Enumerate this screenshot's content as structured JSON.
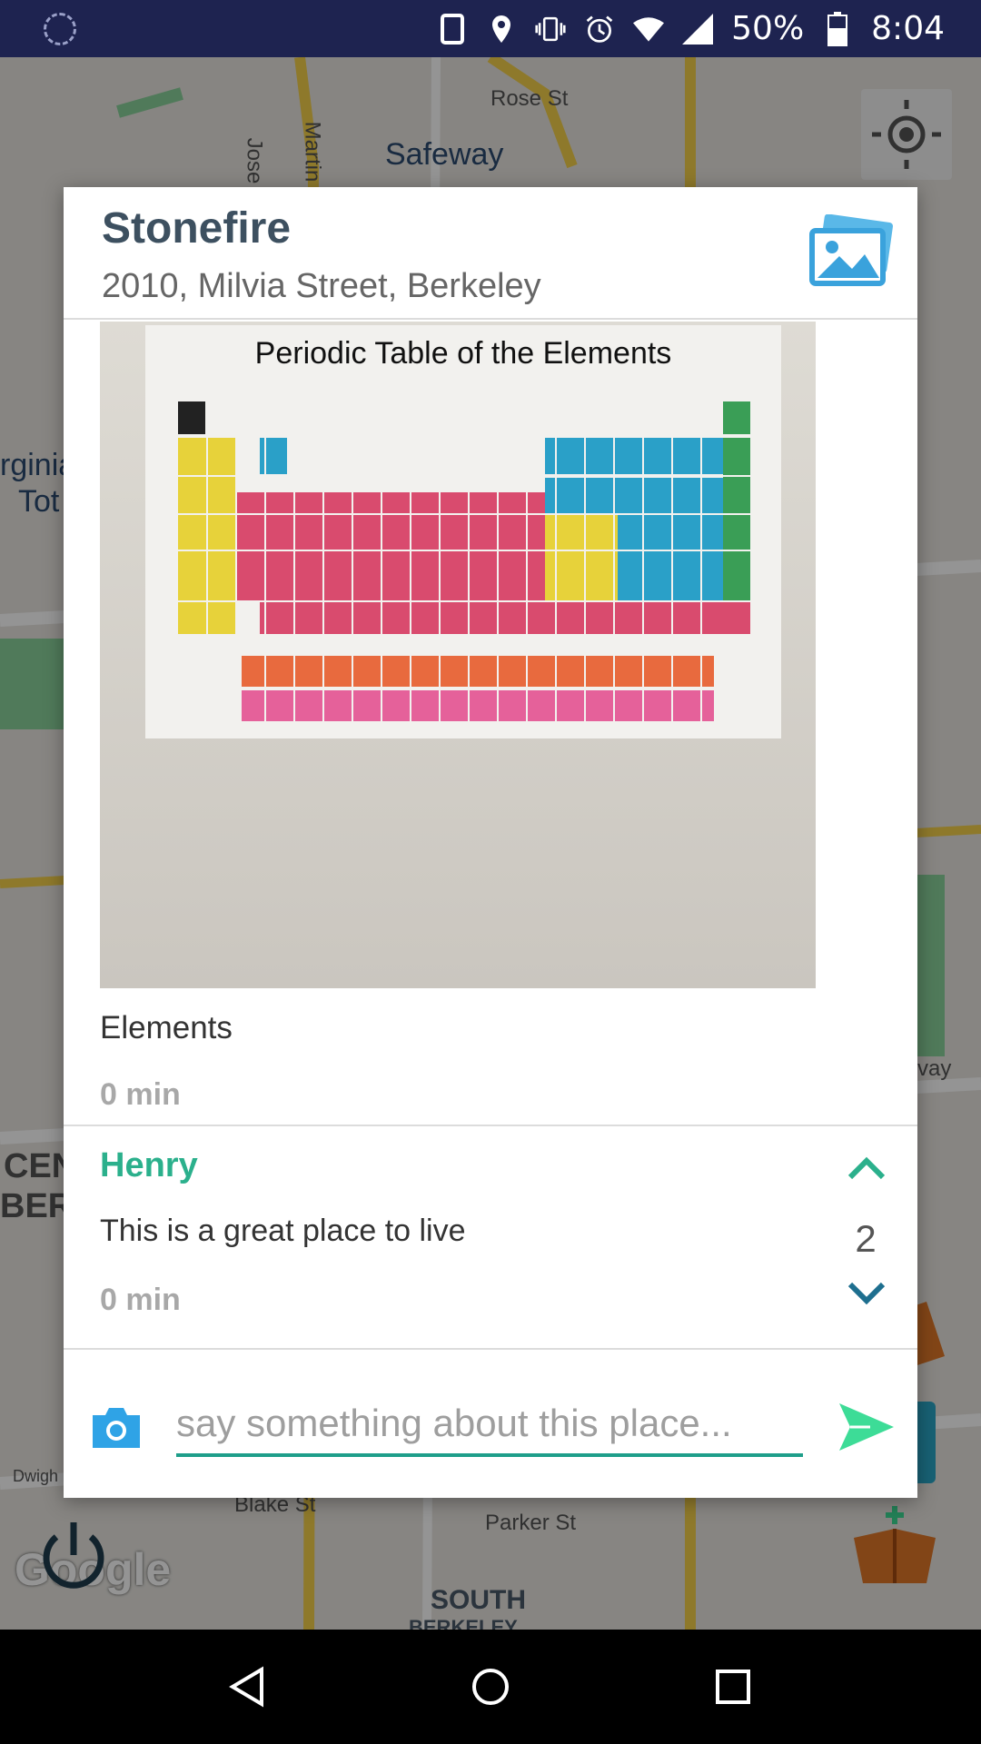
{
  "status_bar": {
    "battery": "50%",
    "time": "8:04"
  },
  "map": {
    "labels": {
      "rose_st": "Rose St",
      "safeway": "Safeway",
      "jose": "Jose",
      "martin": "Martin",
      "virginia": "rginia",
      "tot": "Tot",
      "cen": "CEN",
      "ber": "BER",
      "blake_st": "Blake St",
      "parker_st": "Parker St",
      "south": "SOUTH",
      "berkeley": "BERKELEY",
      "dwight": "Dwigh",
      "way": "vay",
      "google": "Google"
    }
  },
  "dialog": {
    "title": "Stonefire",
    "address": "2010, Milvia Street, Berkeley",
    "photo": {
      "poster_title": "Periodic Table of the Elements"
    },
    "post": {
      "caption": "Elements",
      "time": "0 min"
    },
    "comment": {
      "author": "Henry",
      "text": "This is a great place to live",
      "time": "0 min",
      "votes": "2"
    },
    "input": {
      "placeholder": "say something about this place...",
      "value": ""
    }
  },
  "colors": {
    "accent": "#2bb08c",
    "title": "#3d5060",
    "downvote": "#1e6f8f",
    "send": "#3ddc97",
    "camera": "#2fa3e6"
  },
  "icons": {
    "gallery": "gallery-icon",
    "upvote": "chevron-up-icon",
    "downvote": "chevron-down-icon",
    "camera": "camera-icon",
    "send": "send-icon"
  }
}
